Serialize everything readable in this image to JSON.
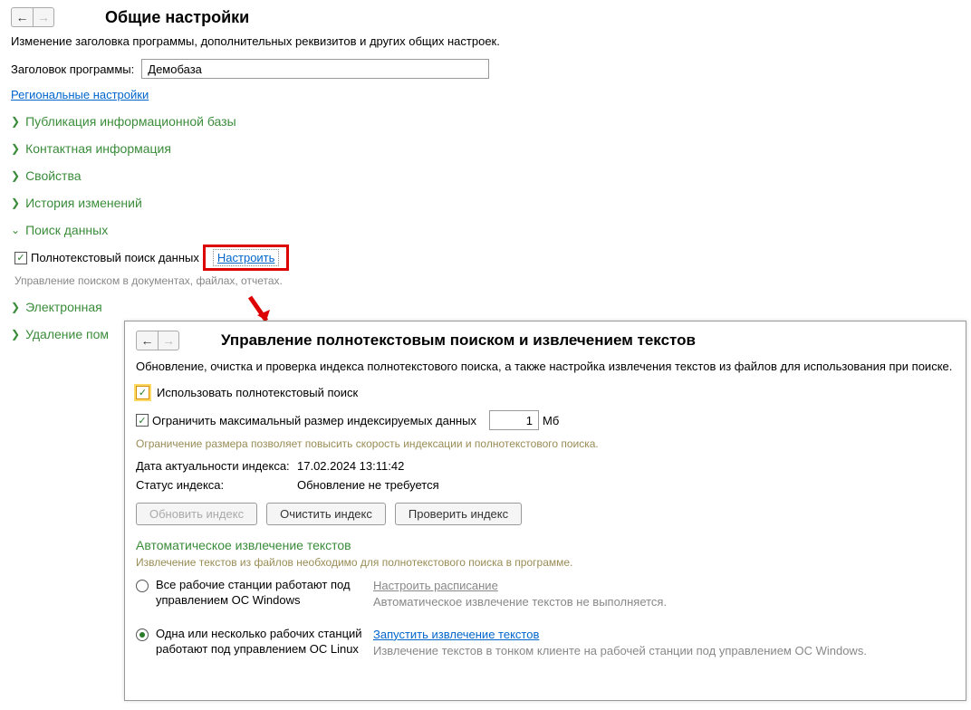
{
  "mainPage": {
    "title": "Общие настройки",
    "subtitle": "Изменение заголовка программы, дополнительных реквизитов и других общих настроек.",
    "programTitleLabel": "Заголовок программы:",
    "programTitleValue": "Демобаза",
    "regionalSettingsLink": "Региональные настройки",
    "sections": {
      "publication": "Публикация информационной базы",
      "contactInfo": "Контактная информация",
      "properties": "Свойства",
      "changeHistory": "История изменений",
      "dataSearch": "Поиск данных",
      "email": "Электронная",
      "deletion": "Удаление пом"
    },
    "dataSearchContent": {
      "fulltextCheckboxLabel": "Полнотекстовый поиск данных",
      "configureLink": "Настроить",
      "hint": "Управление поиском в документах, файлах, отчетах."
    }
  },
  "dialog": {
    "title": "Управление полнотекстовым поиском и извлечением текстов",
    "subtitle": "Обновление, очистка и проверка индекса полнотекстового поиска, а также настройка извлечения текстов из файлов для использования при поиске.",
    "useFulltextLabel": "Использовать полнотекстовый поиск",
    "limitSizeLabel": "Ограничить максимальный размер индексируемых данных",
    "limitSizeValue": "1",
    "mbLabel": "Мб",
    "sizeLimitHint": "Ограничение размера позволяет повысить скорость индексации и полнотекстового поиска.",
    "indexDateLabel": "Дата актуальности индекса:",
    "indexDateValue": "17.02.2024 13:11:42",
    "indexStatusLabel": "Статус индекса:",
    "indexStatusValue": "Обновление не требуется",
    "updateIndexBtn": "Обновить индекс",
    "clearIndexBtn": "Очистить индекс",
    "checkIndexBtn": "Проверить индекс",
    "autoExtractHeading": "Автоматическое извлечение текстов",
    "autoExtractHint": "Извлечение текстов из файлов необходимо для полнотекстового поиска в программе.",
    "radioWindows": "Все рабочие станции работают под управлением ОС Windows",
    "radioLinux": "Одна или несколько рабочих станций работают под управлением ОС Linux",
    "configureScheduleLink": "Настроить расписание",
    "autoExtractStatus": "Автоматическое извлечение текстов не выполняется.",
    "runExtractLink": "Запустить извлечение текстов",
    "thinClientHint": "Извлечение текстов в тонком клиенте на рабочей станции под управлением ОС Windows."
  }
}
